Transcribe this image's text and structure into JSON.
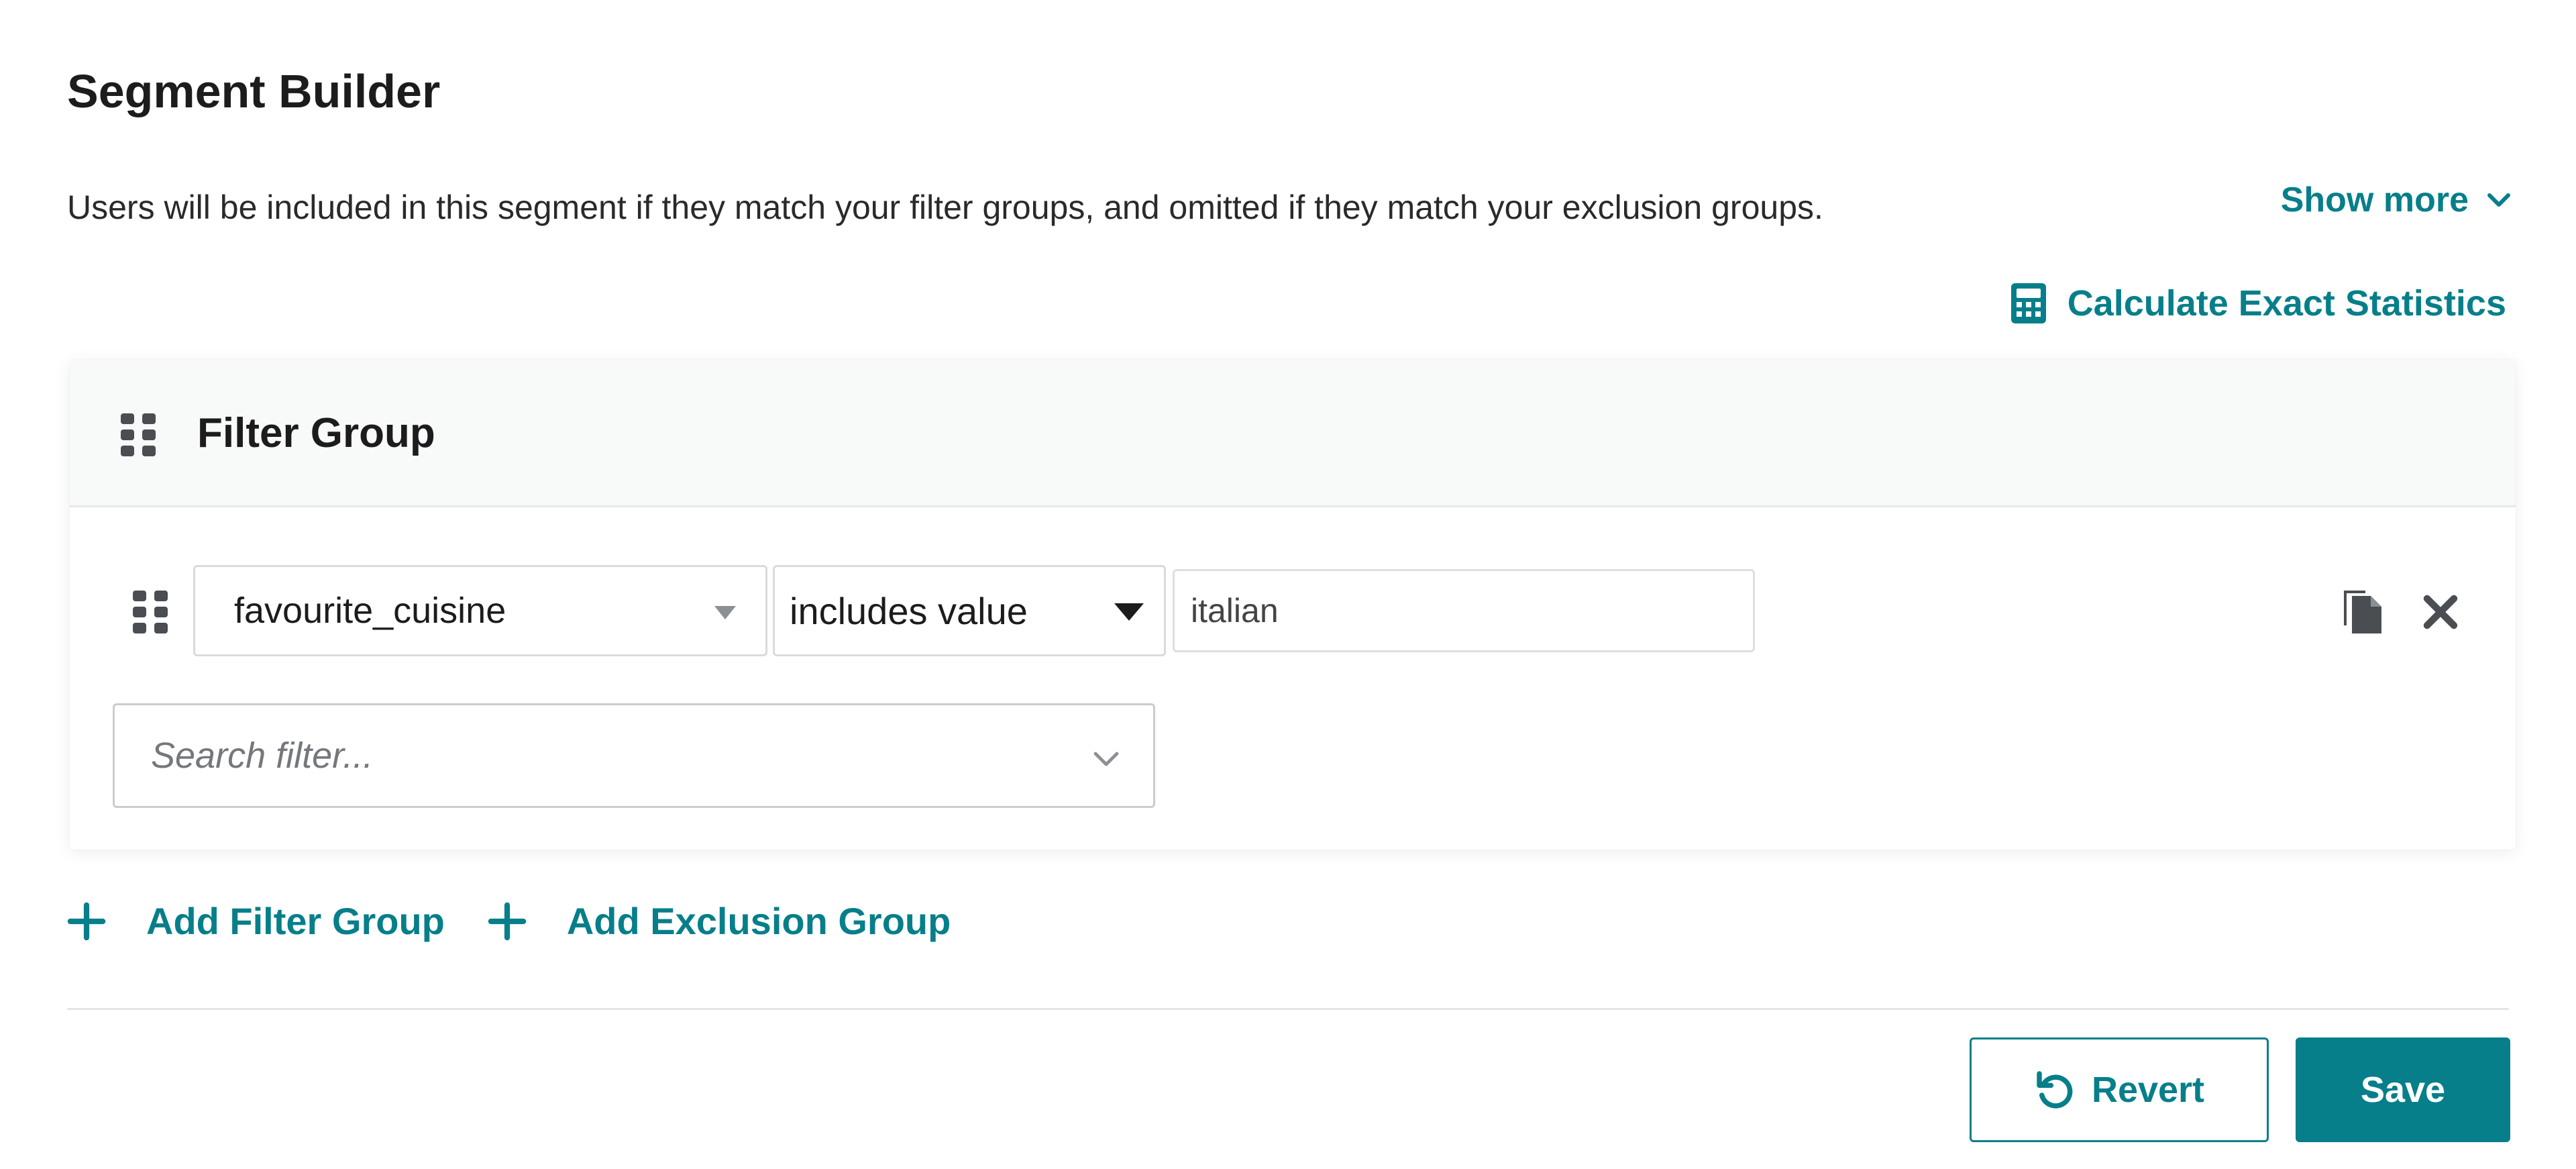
{
  "header": {
    "title": "Segment Builder",
    "description": "Users will be included in this segment if they match your filter groups, and omitted if they match your exclusion groups.",
    "show_more": "Show more",
    "calculate_link": "Calculate Exact Statistics"
  },
  "filter_group": {
    "title": "Filter Group",
    "row": {
      "property": "favourite_cuisine",
      "operator": "includes value",
      "value": "italian"
    },
    "search_placeholder": "Search filter..."
  },
  "actions": {
    "add_filter_group": "Add Filter Group",
    "add_exclusion_group": "Add Exclusion Group"
  },
  "footer": {
    "revert_label": "Revert",
    "save_label": "Save"
  },
  "colors": {
    "accent": "#077f8a",
    "text": "#1c1c1e"
  },
  "icons": [
    "chevron-down-icon",
    "calculator-icon",
    "drag-handle-icon",
    "copy-icon",
    "close-icon",
    "plus-icon",
    "undo-icon"
  ]
}
